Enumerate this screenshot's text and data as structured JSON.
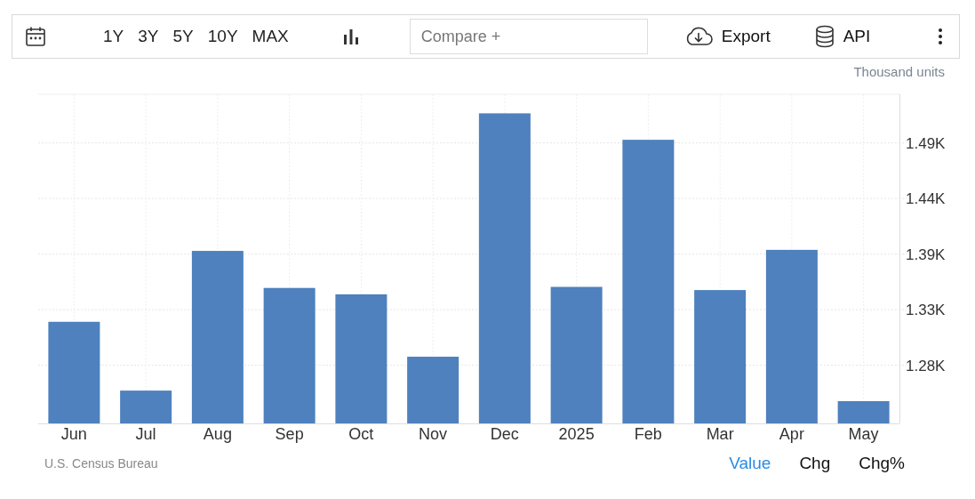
{
  "toolbar": {
    "ranges": [
      "1Y",
      "3Y",
      "5Y",
      "10Y",
      "MAX"
    ],
    "compare": {
      "placeholder": "Compare +"
    },
    "export": "Export",
    "api": "API"
  },
  "chart": {
    "unit_label": "Thousand units",
    "chart_data": {
      "type": "bar",
      "categories": [
        "Jun",
        "Jul",
        "Aug",
        "Sep",
        "Oct",
        "Nov",
        "Dec",
        "2025",
        "Feb",
        "Mar",
        "Apr",
        "May"
      ],
      "grid": true,
      "series": [
        {
          "color": "#4e81bd",
          "values": [
            1321,
            1256,
            1388,
            1353,
            1347,
            1288,
            1518,
            1354,
            1493,
            1351,
            1389,
            1246
          ]
        }
      ],
      "ylim": [
        1225,
        1536
      ],
      "yticks": [
        {
          "value": 1280,
          "label": "1.28K"
        },
        {
          "value": 1332.5,
          "label": "1.33K"
        },
        {
          "value": 1385,
          "label": "1.39K"
        },
        {
          "value": 1437.5,
          "label": "1.44K"
        },
        {
          "value": 1490,
          "label": "1.49K"
        }
      ]
    }
  },
  "footer": {
    "source": "U.S. Census Bureau",
    "views": [
      {
        "label": "Value",
        "selected": true
      },
      {
        "label": "Chg",
        "selected": false
      },
      {
        "label": "Chg%",
        "selected": false
      }
    ]
  }
}
